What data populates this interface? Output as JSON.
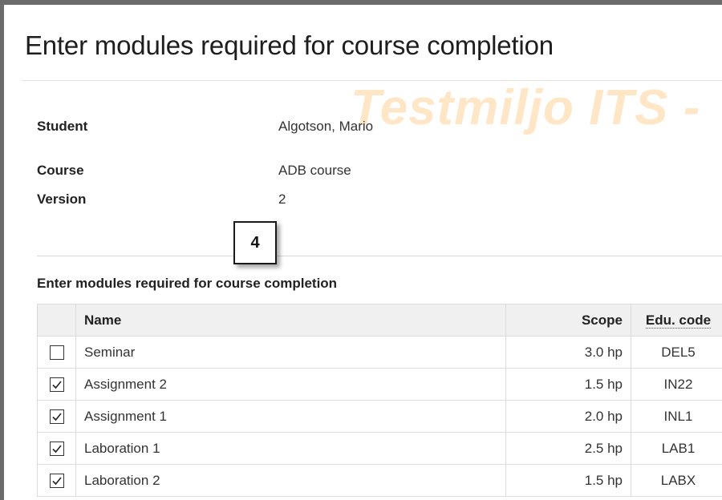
{
  "page": {
    "title": "Enter modules required for course completion"
  },
  "watermark": {
    "text": "Testmiljo ITS -"
  },
  "info": {
    "student_label": "Student",
    "student_value": "Algotson, Mario",
    "course_label": "Course",
    "course_value": "ADB course",
    "version_label": "Version",
    "version_value": "2"
  },
  "callout": {
    "number": "4"
  },
  "modules": {
    "heading": "Enter modules required for course completion",
    "columns": {
      "name": "Name",
      "scope": "Scope",
      "code": "Edu. code"
    },
    "rows": [
      {
        "checked": false,
        "name": "Seminar",
        "scope": "3.0 hp",
        "code": "DEL5"
      },
      {
        "checked": true,
        "name": "Assignment 2",
        "scope": "1.5 hp",
        "code": "IN22"
      },
      {
        "checked": true,
        "name": "Assignment 1",
        "scope": "2.0 hp",
        "code": "INL1"
      },
      {
        "checked": true,
        "name": "Laboration 1",
        "scope": "2.5 hp",
        "code": "LAB1"
      },
      {
        "checked": true,
        "name": "Laboration 2",
        "scope": "1.5 hp",
        "code": "LABX"
      }
    ]
  },
  "icons": {
    "checkbox_checked": "checkbox-checked-icon",
    "checkbox_unchecked": "checkbox-unchecked-icon"
  }
}
